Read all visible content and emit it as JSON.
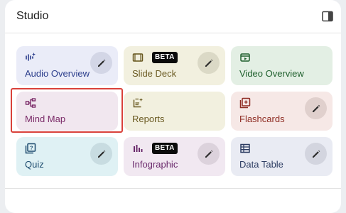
{
  "studio": {
    "title": "Studio",
    "toggle_icon": "panel-toggle-icon"
  },
  "cards": [
    {
      "label": "Audio Overview",
      "icon": "audio-waveform-icon",
      "beta": "",
      "has_edit": true
    },
    {
      "label": "Slide Deck",
      "icon": "slides-icon",
      "beta": "BETA",
      "has_edit": true
    },
    {
      "label": "Video Overview",
      "icon": "video-icon",
      "beta": "",
      "has_edit": false
    },
    {
      "label": "Mind Map",
      "icon": "mind-map-icon",
      "beta": "",
      "has_edit": false,
      "selected": true
    },
    {
      "label": "Reports",
      "icon": "reports-icon",
      "beta": "",
      "has_edit": false
    },
    {
      "label": "Flashcards",
      "icon": "flashcards-icon",
      "beta": "",
      "has_edit": true
    },
    {
      "label": "Quiz",
      "icon": "quiz-icon",
      "beta": "",
      "has_edit": true
    },
    {
      "label": "Infographic",
      "icon": "infographic-icon",
      "beta": "BETA",
      "has_edit": true
    },
    {
      "label": "Data Table",
      "icon": "table-icon",
      "beta": "",
      "has_edit": true
    }
  ],
  "colors": {
    "selection_outline": "#d9413a",
    "background": "#eceef1"
  }
}
